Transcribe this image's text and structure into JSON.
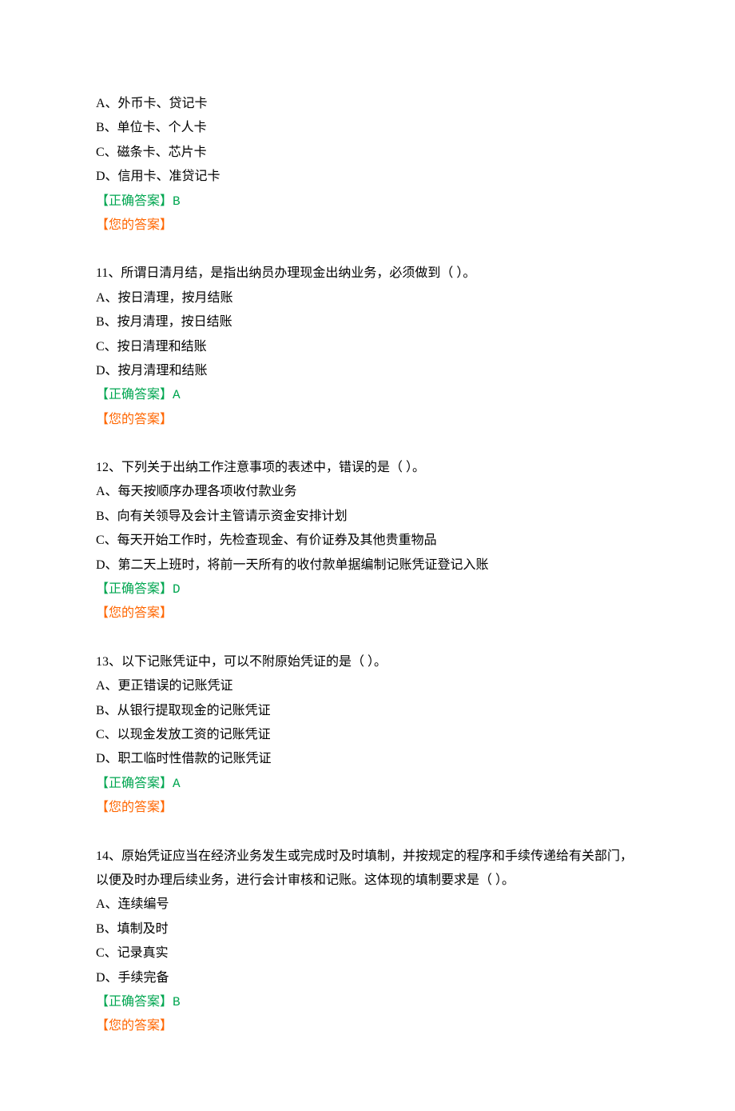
{
  "questions": [
    {
      "number": "",
      "stem": "",
      "options": [
        "A、外币卡、贷记卡",
        "B、单位卡、个人卡",
        "C、磁条卡、芯片卡",
        "D、信用卡、准贷记卡"
      ],
      "correct_label": "【正确答案】",
      "correct_value": "B",
      "your_label": "【您的答案】"
    },
    {
      "number": "11、",
      "stem": "所谓日清月结，是指出纳员办理现金出纳业务，必须做到（  ）。",
      "options": [
        "A、按日清理，按月结账",
        "B、按月清理，按日结账",
        "C、按日清理和结账",
        "D、按月清理和结账"
      ],
      "correct_label": "【正确答案】",
      "correct_value": "A",
      "your_label": "【您的答案】"
    },
    {
      "number": "12、",
      "stem": "下列关于出纳工作注意事项的表述中，错误的是（  ）。",
      "options": [
        "A、每天按顺序办理各项收付款业务",
        "B、向有关领导及会计主管请示资金安排计划",
        "C、每天开始工作时，先检查现金、有价证券及其他贵重物品",
        "D、第二天上班时，将前一天所有的收付款单据编制记账凭证登记入账"
      ],
      "correct_label": "【正确答案】",
      "correct_value": "D",
      "your_label": "【您的答案】"
    },
    {
      "number": "13、",
      "stem": "以下记账凭证中，可以不附原始凭证的是（  ）。",
      "options": [
        "A、更正错误的记账凭证",
        "B、从银行提取现金的记账凭证",
        "C、以现金发放工资的记账凭证",
        "D、职工临时性借款的记账凭证"
      ],
      "correct_label": "【正确答案】",
      "correct_value": "A",
      "your_label": "【您的答案】"
    },
    {
      "number": "14、",
      "stem": "原始凭证应当在经济业务发生或完成时及时填制，并按规定的程序和手续传递给有关部门，以便及时办理后续业务，进行会计审核和记账。这体现的填制要求是（  ）。",
      "options": [
        "A、连续编号",
        "B、填制及时",
        "C、记录真实",
        "D、手续完备"
      ],
      "correct_label": "【正确答案】",
      "correct_value": "B",
      "your_label": "【您的答案】"
    }
  ]
}
